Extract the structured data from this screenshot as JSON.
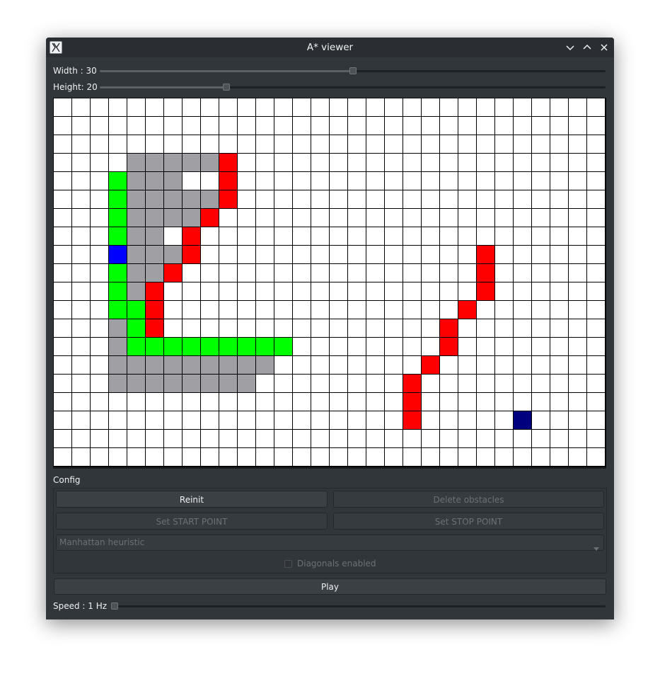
{
  "window": {
    "title": "A* viewer",
    "icon": "x11-app-icon"
  },
  "controls": {
    "width": {
      "label": "Width : 30",
      "value": 30,
      "fraction": 0.5
    },
    "height": {
      "label": "Height: 20",
      "value": 20,
      "fraction": 0.25
    },
    "speed": {
      "label": "Speed : 1 Hz",
      "value": 1,
      "fraction": 0.0
    }
  },
  "grid": {
    "cols": 30,
    "rows": 20,
    "colors": {
      "empty": "#ffffff",
      "start": "#0000ff",
      "stop": "#00007f",
      "obstacle": "#ff0000",
      "path": "#00ff00",
      "explored": "#a0a0a4"
    },
    "start": [
      8,
      3
    ],
    "stop": [
      17,
      25
    ],
    "obstacles": [
      [
        3,
        9
      ],
      [
        4,
        9
      ],
      [
        5,
        9
      ],
      [
        6,
        8
      ],
      [
        7,
        7
      ],
      [
        8,
        7
      ],
      [
        9,
        6
      ],
      [
        10,
        5
      ],
      [
        11,
        5
      ],
      [
        12,
        5
      ],
      [
        8,
        23
      ],
      [
        9,
        23
      ],
      [
        10,
        23
      ],
      [
        11,
        22
      ],
      [
        12,
        21
      ],
      [
        13,
        21
      ],
      [
        14,
        20
      ],
      [
        15,
        19
      ],
      [
        16,
        19
      ],
      [
        17,
        19
      ]
    ],
    "path": [
      [
        4,
        3
      ],
      [
        5,
        3
      ],
      [
        6,
        3
      ],
      [
        7,
        3
      ],
      [
        8,
        3
      ],
      [
        9,
        3
      ],
      [
        10,
        3
      ],
      [
        11,
        3
      ],
      [
        11,
        4
      ],
      [
        12,
        4
      ],
      [
        13,
        4
      ],
      [
        13,
        5
      ],
      [
        13,
        6
      ],
      [
        13,
        7
      ],
      [
        13,
        8
      ],
      [
        13,
        9
      ],
      [
        13,
        10
      ],
      [
        13,
        11
      ],
      [
        13,
        12
      ]
    ],
    "explored": [
      [
        3,
        4
      ],
      [
        3,
        5
      ],
      [
        3,
        6
      ],
      [
        3,
        7
      ],
      [
        3,
        8
      ],
      [
        4,
        4
      ],
      [
        4,
        5
      ],
      [
        4,
        6
      ],
      [
        5,
        4
      ],
      [
        5,
        5
      ],
      [
        5,
        6
      ],
      [
        5,
        7
      ],
      [
        5,
        8
      ],
      [
        6,
        4
      ],
      [
        6,
        5
      ],
      [
        6,
        6
      ],
      [
        6,
        7
      ],
      [
        7,
        4
      ],
      [
        7,
        5
      ],
      [
        8,
        4
      ],
      [
        8,
        5
      ],
      [
        8,
        6
      ],
      [
        9,
        4
      ],
      [
        9,
        5
      ],
      [
        10,
        4
      ],
      [
        12,
        3
      ],
      [
        13,
        3
      ],
      [
        14,
        3
      ],
      [
        14,
        4
      ],
      [
        14,
        5
      ],
      [
        14,
        6
      ],
      [
        14,
        7
      ],
      [
        14,
        8
      ],
      [
        14,
        9
      ],
      [
        14,
        10
      ],
      [
        14,
        11
      ],
      [
        15,
        3
      ],
      [
        15,
        4
      ],
      [
        15,
        5
      ],
      [
        15,
        6
      ],
      [
        15,
        7
      ],
      [
        15,
        8
      ],
      [
        15,
        9
      ],
      [
        15,
        10
      ]
    ]
  },
  "config": {
    "label": "Config",
    "reinit": "Reinit",
    "delete_obstacles": "Delete obstacles",
    "set_start": "Set START POINT",
    "set_stop": "Set STOP POINT",
    "heuristic": "Manhattan heuristic",
    "diagonals": "Diagonals enabled",
    "diagonals_checked": false
  },
  "play": "Play"
}
